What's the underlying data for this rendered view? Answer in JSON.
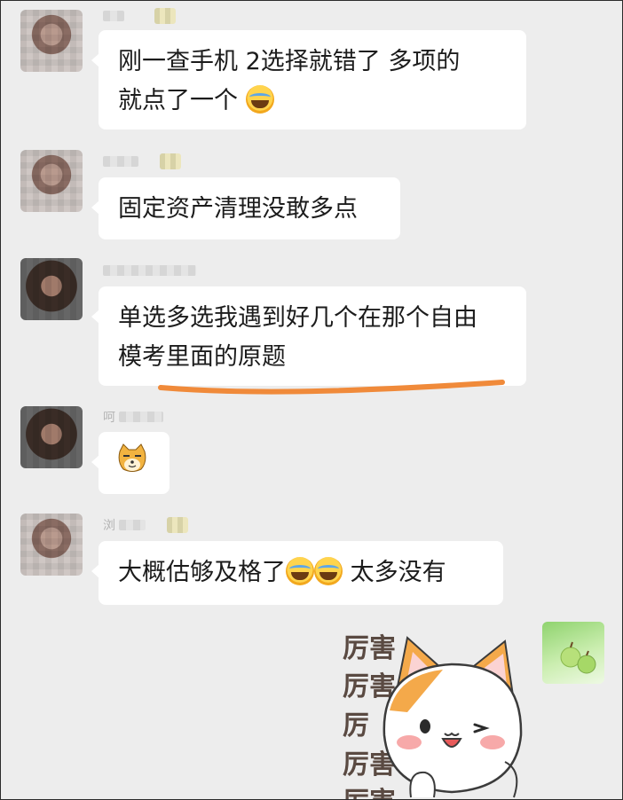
{
  "messages": [
    {
      "text_line1": "刚一查手机 2选择就错了 多项的",
      "text_line2": "就点了一个",
      "emoji": "laughing-crying-face-icon"
    },
    {
      "text_line1": "固定资产清理没敢多点"
    },
    {
      "text_line1": "单选多选我遇到好几个在那个自由",
      "text_line2": "模考里面的原题",
      "underline_color": "#f08a3a"
    },
    {
      "sticker": "doge-face-icon"
    },
    {
      "text_part1": "大概估够及格了",
      "text_part2": " 太多没有",
      "emoji": "laughing-crying-face-icon"
    }
  ],
  "sender_names": {
    "msg4": "呵",
    "msg5": "浏"
  },
  "sticker_text": [
    "厉害",
    "厉害",
    "厉",
    "厉害",
    "厉害"
  ],
  "colors": {
    "background": "#ededed",
    "bubble": "#ffffff",
    "underline": "#f08a3a"
  }
}
